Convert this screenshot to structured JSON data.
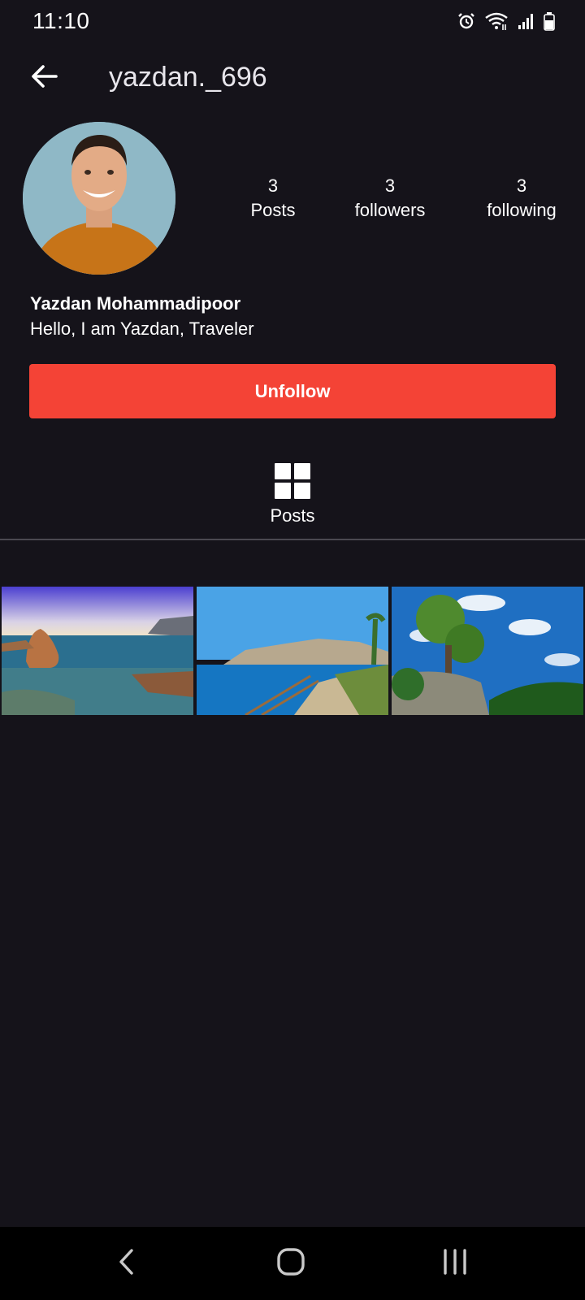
{
  "status_bar": {
    "time": "11:10",
    "icons": [
      "alarm-icon",
      "wifi-icon",
      "signal-icon",
      "battery-icon"
    ]
  },
  "header": {
    "username": "yazdan._696",
    "back_icon": "back-arrow-icon"
  },
  "profile": {
    "stats": [
      {
        "value": "3",
        "label": "Posts"
      },
      {
        "value": "3",
        "label": "followers"
      },
      {
        "value": "3",
        "label": "following"
      }
    ],
    "name": "Yazdan Mohammadipoor",
    "bio": "Hello, I am Yazdan, Traveler"
  },
  "actions": {
    "unfollow_label": "Unfollow",
    "unfollow_color": "#f44336"
  },
  "tabs": {
    "posts_label": "Posts",
    "posts_icon": "grid-icon"
  },
  "posts": [
    {
      "name": "post-rocky-coast"
    },
    {
      "name": "post-coastal-path"
    },
    {
      "name": "post-pine-trees"
    }
  ],
  "nav": {
    "buttons": [
      "back-icon",
      "home-icon",
      "recents-icon"
    ]
  },
  "colors": {
    "background": "#15131a",
    "accent": "#f44336",
    "divider": "#4a4850"
  }
}
